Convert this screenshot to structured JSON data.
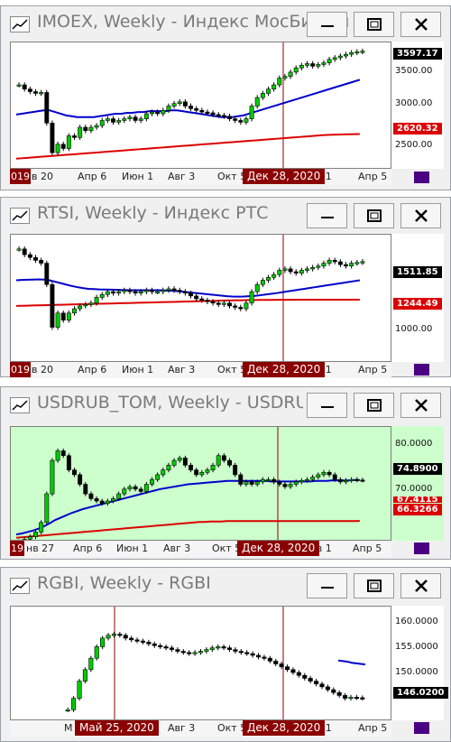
{
  "windows": [
    {
      "title": "IMOEX, Weekly - Индекс МосБиржи",
      "bg": "#ffffff",
      "corner_label": "019",
      "x_labels": [
        "в 20",
        "Апр 6",
        "Июн 1",
        "Авг 3",
        "Окт 5",
        "ев 1",
        "Апр 5"
      ],
      "cursor_label": "Дек 28, 2020",
      "y_labels": [
        "3500.00",
        "3000.00",
        "2500.00"
      ],
      "tags": [
        {
          "text": "3597.17",
          "bg": "#000000",
          "fg": "#ffffff"
        },
        {
          "text": "2620.32",
          "bg": "#dd0000",
          "fg": "#ffffff"
        }
      ]
    },
    {
      "title": "RTSI, Weekly - Индекс РТС",
      "bg": "#ffffff",
      "corner_label": "019",
      "x_labels": [
        "в 20",
        "Апр 6",
        "Июн 1",
        "Авг 3",
        "Окт 5",
        "ев 1",
        "Апр 5"
      ],
      "cursor_label": "Дек 28, 2020",
      "y_labels": [
        "1000.00"
      ],
      "tags": [
        {
          "text": "1511.85",
          "bg": "#000000",
          "fg": "#ffffff"
        },
        {
          "text": "1244.49",
          "bg": "#dd0000",
          "fg": "#ffffff"
        }
      ]
    },
    {
      "title": "USDRUB_TOM, Weekly - USDRUB_T...",
      "bg": "#ccffcc",
      "corner_label": "19",
      "x_labels": [
        "нв 27",
        "Апр 6",
        "Июн 1",
        "Авг 3",
        "Окт 5",
        "ев 1",
        "Апр 5"
      ],
      "cursor_label": "Дек 28, 2020",
      "y_labels": [
        "80.0000",
        "70.0000"
      ],
      "tags": [
        {
          "text": "74.8900",
          "bg": "#000000",
          "fg": "#ffffff"
        },
        {
          "text": "67.4115",
          "bg": "#dd0000",
          "fg": "#ffffff"
        },
        {
          "text": "66.3266",
          "bg": "#dd0000",
          "fg": "#ffffff"
        }
      ]
    },
    {
      "title": "RGBI, Weekly - RGBI",
      "bg": "#ffffff",
      "corner_label": "",
      "x_labels": [
        "М",
        "Авг 3",
        "Окт 5",
        "ев 1",
        "Апр 5"
      ],
      "cursor_label": "Дек 28, 2020",
      "cursor_label2": "Май 25, 2020",
      "y_labels": [
        "160.0000",
        "155.0000",
        "150.0000",
        "146.0200"
      ],
      "tags": [
        {
          "text": "146.0200",
          "bg": "#000000",
          "fg": "#ffffff"
        }
      ]
    }
  ],
  "chart_data": [
    {
      "type": "candlestick",
      "title": "IMOEX, Weekly - Индекс МосБиржи",
      "ylim": [
        2200,
        3700
      ],
      "close": [
        3200,
        3150,
        3120,
        3100,
        3110,
        2750,
        2400,
        2500,
        2450,
        2600,
        2580,
        2700,
        2660,
        2700,
        2720,
        2780,
        2800,
        2760,
        2780,
        2800,
        2820,
        2780,
        2800,
        2860,
        2880,
        2860,
        2900,
        2950,
        2980,
        3000,
        2950,
        2920,
        2900,
        2880,
        2870,
        2850,
        2840,
        2830,
        2800,
        2780,
        2760,
        2800,
        2950,
        3050,
        3100,
        3150,
        3200,
        3280,
        3300,
        3350,
        3400,
        3430,
        3450,
        3420,
        3440,
        3460,
        3500,
        3520,
        3540,
        3560,
        3580,
        3590,
        3597
      ],
      "series": [
        {
          "name": "MA blue",
          "color": "#0000cc",
          "values": [
            2850,
            2860,
            2870,
            2880,
            2890,
            2900,
            2900,
            2880,
            2860,
            2840,
            2830,
            2820,
            2820,
            2820,
            2820,
            2830,
            2840,
            2850,
            2860,
            2860,
            2870,
            2870,
            2880,
            2880,
            2890,
            2890,
            2890,
            2890,
            2900,
            2900,
            2890,
            2880,
            2870,
            2860,
            2850,
            2840,
            2830,
            2820,
            2820,
            2820,
            2830,
            2840,
            2860,
            2880,
            2900,
            2920,
            2940,
            2960,
            2980,
            3000,
            3020,
            3040,
            3060,
            3080,
            3100,
            3120,
            3140,
            3160,
            3180,
            3200,
            3220,
            3240,
            3260
          ]
        },
        {
          "name": "MA red",
          "color": "#dd0000",
          "values": [
            2330,
            2335,
            2340,
            2345,
            2350,
            2355,
            2360,
            2365,
            2370,
            2375,
            2380,
            2385,
            2390,
            2395,
            2400,
            2405,
            2410,
            2415,
            2420,
            2425,
            2430,
            2435,
            2440,
            2445,
            2450,
            2455,
            2460,
            2465,
            2470,
            2475,
            2480,
            2485,
            2490,
            2495,
            2500,
            2505,
            2510,
            2515,
            2520,
            2525,
            2530,
            2535,
            2540,
            2545,
            2550,
            2555,
            2560,
            2565,
            2570,
            2575,
            2580,
            2585,
            2590,
            2595,
            2600,
            2605,
            2610,
            2612,
            2614,
            2616,
            2618,
            2619,
            2620
          ]
        }
      ]
    },
    {
      "type": "candlestick",
      "title": "RTSI, Weekly - Индекс РТС",
      "ylim": [
        800,
        1700
      ],
      "close": [
        1600,
        1560,
        1540,
        1520,
        1500,
        1350,
        1050,
        1150,
        1100,
        1150,
        1180,
        1200,
        1210,
        1220,
        1260,
        1280,
        1300,
        1290,
        1300,
        1310,
        1300,
        1290,
        1300,
        1310,
        1300,
        1300,
        1310,
        1320,
        1310,
        1300,
        1290,
        1270,
        1250,
        1240,
        1230,
        1220,
        1210,
        1220,
        1200,
        1190,
        1180,
        1220,
        1300,
        1350,
        1380,
        1400,
        1420,
        1450,
        1460,
        1440,
        1430,
        1450,
        1460,
        1470,
        1480,
        1500,
        1520,
        1510,
        1490,
        1480,
        1500,
        1505,
        1511
      ],
      "series": [
        {
          "name": "MA blue",
          "color": "#0000cc",
          "values": [
            1380,
            1382,
            1384,
            1385,
            1386,
            1385,
            1380,
            1370,
            1360,
            1350,
            1340,
            1332,
            1325,
            1320,
            1318,
            1316,
            1315,
            1314,
            1313,
            1312,
            1311,
            1310,
            1310,
            1310,
            1310,
            1310,
            1310,
            1308,
            1306,
            1304,
            1300,
            1296,
            1292,
            1288,
            1284,
            1280,
            1276,
            1272,
            1268,
            1266,
            1265,
            1266,
            1268,
            1270,
            1275,
            1280,
            1285,
            1290,
            1296,
            1302,
            1308,
            1314,
            1320,
            1326,
            1332,
            1338,
            1344,
            1350,
            1356,
            1362,
            1368,
            1374,
            1380
          ]
        },
        {
          "name": "MA red",
          "color": "#dd0000",
          "values": [
            1200,
            1201,
            1202,
            1203,
            1204,
            1205,
            1206,
            1207,
            1208,
            1209,
            1210,
            1211,
            1212,
            1213,
            1214,
            1215,
            1216,
            1217,
            1218,
            1219,
            1220,
            1221,
            1222,
            1223,
            1224,
            1225,
            1226,
            1227,
            1228,
            1229,
            1230,
            1231,
            1232,
            1233,
            1234,
            1235,
            1236,
            1237,
            1238,
            1239,
            1240,
            1240,
            1241,
            1241,
            1242,
            1242,
            1242,
            1243,
            1243,
            1243,
            1243,
            1244,
            1244,
            1244,
            1244,
            1244,
            1244,
            1244,
            1244,
            1244,
            1244,
            1244,
            1244
          ]
        }
      ]
    },
    {
      "type": "candlestick",
      "title": "USDRUB_TOM, Weekly - USDRUB_T...",
      "ylim": [
        62,
        86
      ],
      "close": [
        62,
        62.5,
        63,
        64,
        66,
        72,
        79,
        81,
        80,
        77,
        76,
        74,
        72,
        71,
        70.5,
        70,
        70.5,
        71,
        72,
        73,
        73.5,
        73,
        72.5,
        74,
        75,
        76,
        77,
        78,
        79,
        79.5,
        78,
        77,
        76,
        76.5,
        77,
        78,
        80,
        79,
        78,
        76,
        74,
        74.5,
        74,
        74.5,
        75,
        75,
        74.5,
        74,
        73.5,
        74,
        74.5,
        74.8,
        75,
        75.5,
        76,
        76.5,
        76,
        75,
        74.5,
        74.8,
        75,
        74.9,
        74.89
      ],
      "series": [
        {
          "name": "MA blue",
          "color": "#0000cc",
          "values": [
            63.5,
            63.7,
            64,
            64.3,
            64.7,
            65.2,
            65.8,
            66.5,
            67,
            67.5,
            68,
            68.4,
            68.8,
            69.1,
            69.4,
            69.7,
            70,
            70.3,
            70.6,
            70.9,
            71.2,
            71.5,
            71.8,
            72.1,
            72.4,
            72.7,
            73,
            73.2,
            73.4,
            73.6,
            73.8,
            74,
            74.1,
            74.2,
            74.3,
            74.4,
            74.5,
            74.6,
            74.7,
            74.7,
            74.7,
            74.7,
            74.7,
            74.7,
            74.7,
            74.7,
            74.6,
            74.6,
            74.6,
            74.6,
            74.6,
            74.6,
            74.6,
            74.6,
            74.7,
            74.7,
            74.7,
            74.8,
            74.8,
            74.8,
            74.8,
            74.9,
            74.9
          ]
        },
        {
          "name": "MA red",
          "color": "#dd0000",
          "values": [
            62.8,
            62.9,
            63,
            63.1,
            63.2,
            63.3,
            63.4,
            63.5,
            63.6,
            63.7,
            63.8,
            63.9,
            64,
            64.1,
            64.2,
            64.3,
            64.4,
            64.5,
            64.6,
            64.7,
            64.8,
            64.9,
            65,
            65.1,
            65.2,
            65.3,
            65.4,
            65.5,
            65.6,
            65.7,
            65.8,
            65.9,
            66,
            66.1,
            66.1,
            66.2,
            66.2,
            66.2,
            66.3,
            66.3,
            66.3,
            66.3,
            66.3,
            66.3,
            66.3,
            66.3,
            66.3,
            66.3,
            66.3,
            66.3,
            66.3,
            66.3,
            66.3,
            66.3,
            66.3,
            66.3,
            66.3,
            66.3,
            66.3,
            66.3,
            66.3,
            66.3,
            66.33
          ]
        }
      ]
    },
    {
      "type": "candlestick",
      "title": "RGBI, Weekly - RGBI",
      "ylim": [
        142,
        162
      ],
      "close": [
        144,
        146,
        149,
        151,
        153,
        155,
        156.5,
        157,
        157.2,
        157,
        156.5,
        156.2,
        156,
        155.8,
        155.5,
        155.2,
        155,
        154.8,
        154.5,
        154.2,
        154,
        153.8,
        154,
        154.2,
        154.5,
        154.8,
        155,
        154.8,
        154.5,
        154.2,
        154,
        153.8,
        153.5,
        153.2,
        153,
        152.5,
        152,
        151.5,
        151,
        150.5,
        150,
        149.5,
        149,
        148.5,
        148,
        147.5,
        147,
        146.5,
        146,
        146.2,
        146.1,
        146.02
      ],
      "series": [
        {
          "name": "MA blue",
          "color": "#0000cc",
          "values": [
            152.6,
            152.5,
            152.4,
            152.2,
            152.1,
            152,
            151.9
          ]
        }
      ]
    }
  ]
}
